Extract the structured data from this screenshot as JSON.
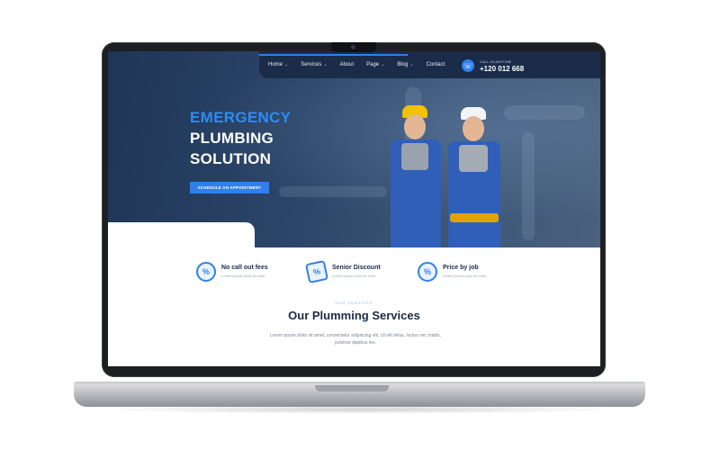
{
  "nav": {
    "items": [
      {
        "label": "Home",
        "dropdown": true
      },
      {
        "label": "Services",
        "dropdown": true
      },
      {
        "label": "About",
        "dropdown": false
      },
      {
        "label": "Page",
        "dropdown": true
      },
      {
        "label": "Blog",
        "dropdown": true
      },
      {
        "label": "Contact",
        "dropdown": false
      }
    ],
    "call_label": "CALL US ANYTIME",
    "phone": "+120 012 668",
    "chevron": "⌄",
    "phone_icon": "phone-icon"
  },
  "hero": {
    "line1": "EMERGENCY",
    "line2": "PLUMBING",
    "line3": "SOLUTION",
    "cta": "SCHEDULE AN APPOINTMENT"
  },
  "features": [
    {
      "title": "No call out fees",
      "subtitle": "Lorem ipsum dolor sit amet",
      "icon": "badge-percent-icon",
      "glyph": "%"
    },
    {
      "title": "Senior Discount",
      "subtitle": "Lorem ipsum dolor sit amet",
      "icon": "tag-icon",
      "glyph": "%"
    },
    {
      "title": "Price by job",
      "subtitle": "Lorem ipsum dolor sit amet",
      "icon": "price-icon",
      "glyph": "%"
    }
  ],
  "services": {
    "eyebrow": "OUR SERVICES",
    "title": "Our Plumming Services",
    "text": "Lorem ipsum dolor sit amet, consectetur adipiscing elit. Ut elit tellus, luctus nec mattis, pulvinar dapibus leo."
  },
  "colors": {
    "accent": "#2f80ed",
    "hero_bg": "#1f3557",
    "heading": "#1b2b45"
  }
}
